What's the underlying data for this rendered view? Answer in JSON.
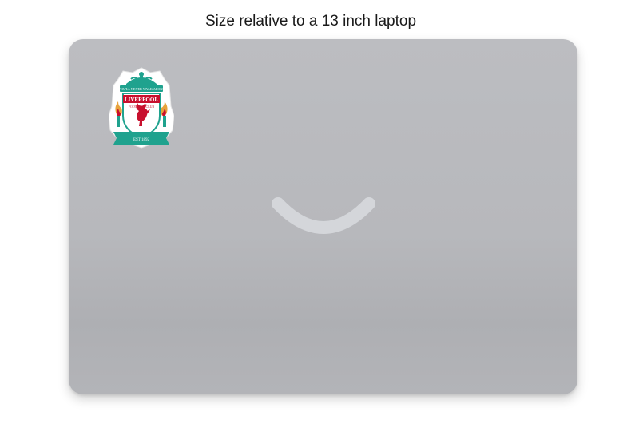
{
  "caption": {
    "text": "Size relative to a 13 inch laptop"
  },
  "sticker": {
    "motto": "YOU'LL NEVER WALK ALONE",
    "club_name": "LIVERPOOL",
    "club_subtitle": "FOOTBALL CLUB",
    "established": "EST 1892"
  },
  "colors": {
    "laptop_body": "#b8b9bd",
    "lid_logo": "#d4d6da",
    "crest_red": "#c8102e",
    "crest_teal": "#1fa28e",
    "crest_gold": "#e8a33c"
  },
  "icons": {
    "lid_logo": "smile-logo-icon",
    "sticker": "liverpool-crest-icon"
  }
}
